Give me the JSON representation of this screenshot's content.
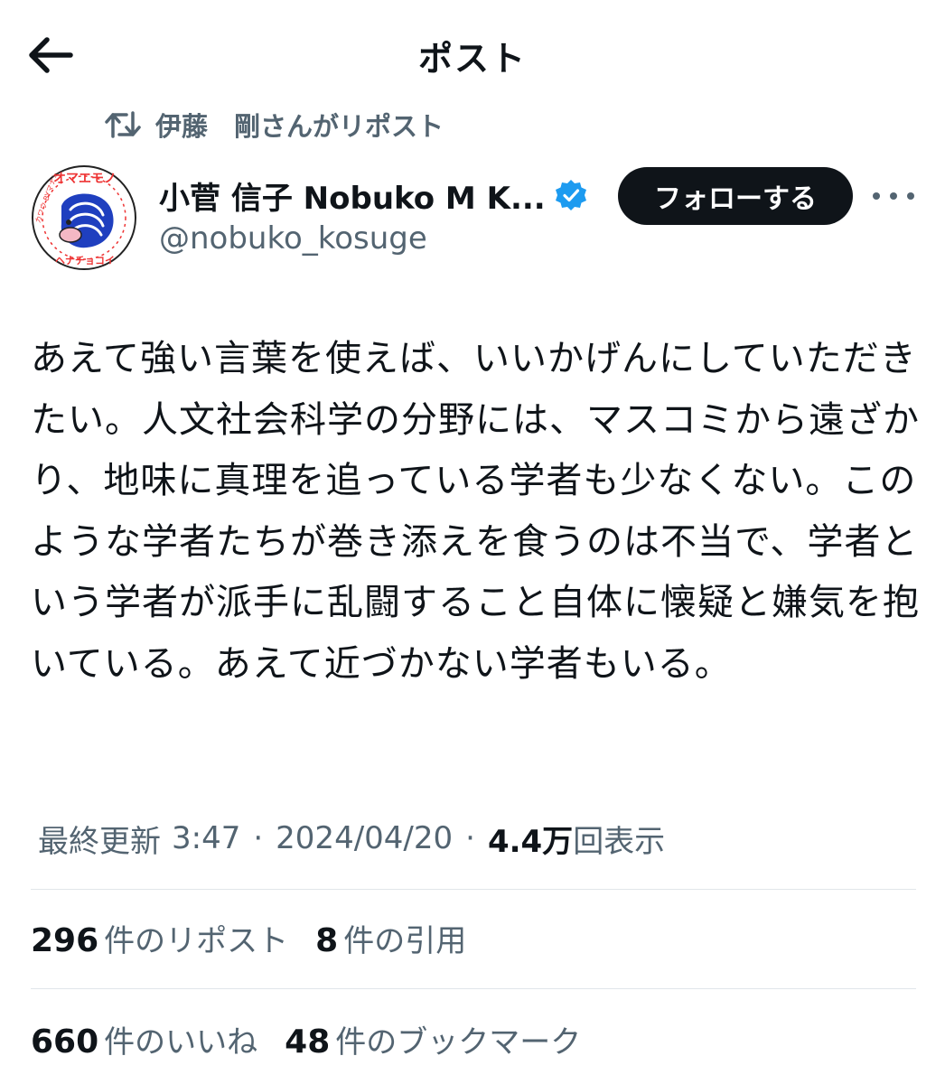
{
  "header": {
    "title": "ポスト",
    "back_icon": "arrow-left-icon"
  },
  "repost": {
    "icon": "repost-icon",
    "text": "伊藤　剛さんがリポスト"
  },
  "author": {
    "display_name": "小菅 信子 Nobuko M K...",
    "handle": "@nobuko_kosuge",
    "verified": true,
    "verified_color": "#1d9bf0",
    "avatar_texts": {
      "top": "オマエモノ",
      "side": "カワウ BYマナミ",
      "bottom": "ヘナチョコイ"
    }
  },
  "follow_button": {
    "label": "フォローする"
  },
  "more_button": {
    "icon": "more-horizontal-icon"
  },
  "post": {
    "text": "あえて強い言葉を使えば、いいかげんにしていただきたい。人文社会科学の分野には、マスコミから遠ざかり、地味に真理を追っている学者も少なくない。このような学者たちが巻き添えを食うのは不当で、学者という学者が派手に乱闘すること自体に懐疑と嫌気を抱いている。あえて近づかない学者もいる。"
  },
  "meta": {
    "prefix": "最終更新",
    "time": "3:47",
    "separator": "·",
    "date": "2024/04/20",
    "separator2": "·",
    "views_count": "4.4万",
    "views_label": "回表示"
  },
  "stats": {
    "reposts_count": "296",
    "reposts_label": "件のリポスト",
    "quotes_count": "8",
    "quotes_label": "件の引用",
    "likes_count": "660",
    "likes_label": "件のいいね",
    "bookmarks_count": "48",
    "bookmarks_label": "件のブックマーク"
  },
  "colors": {
    "text": "#0f1419",
    "muted": "#536471",
    "divider": "#e1e6ea",
    "accent": "#1d9bf0"
  }
}
